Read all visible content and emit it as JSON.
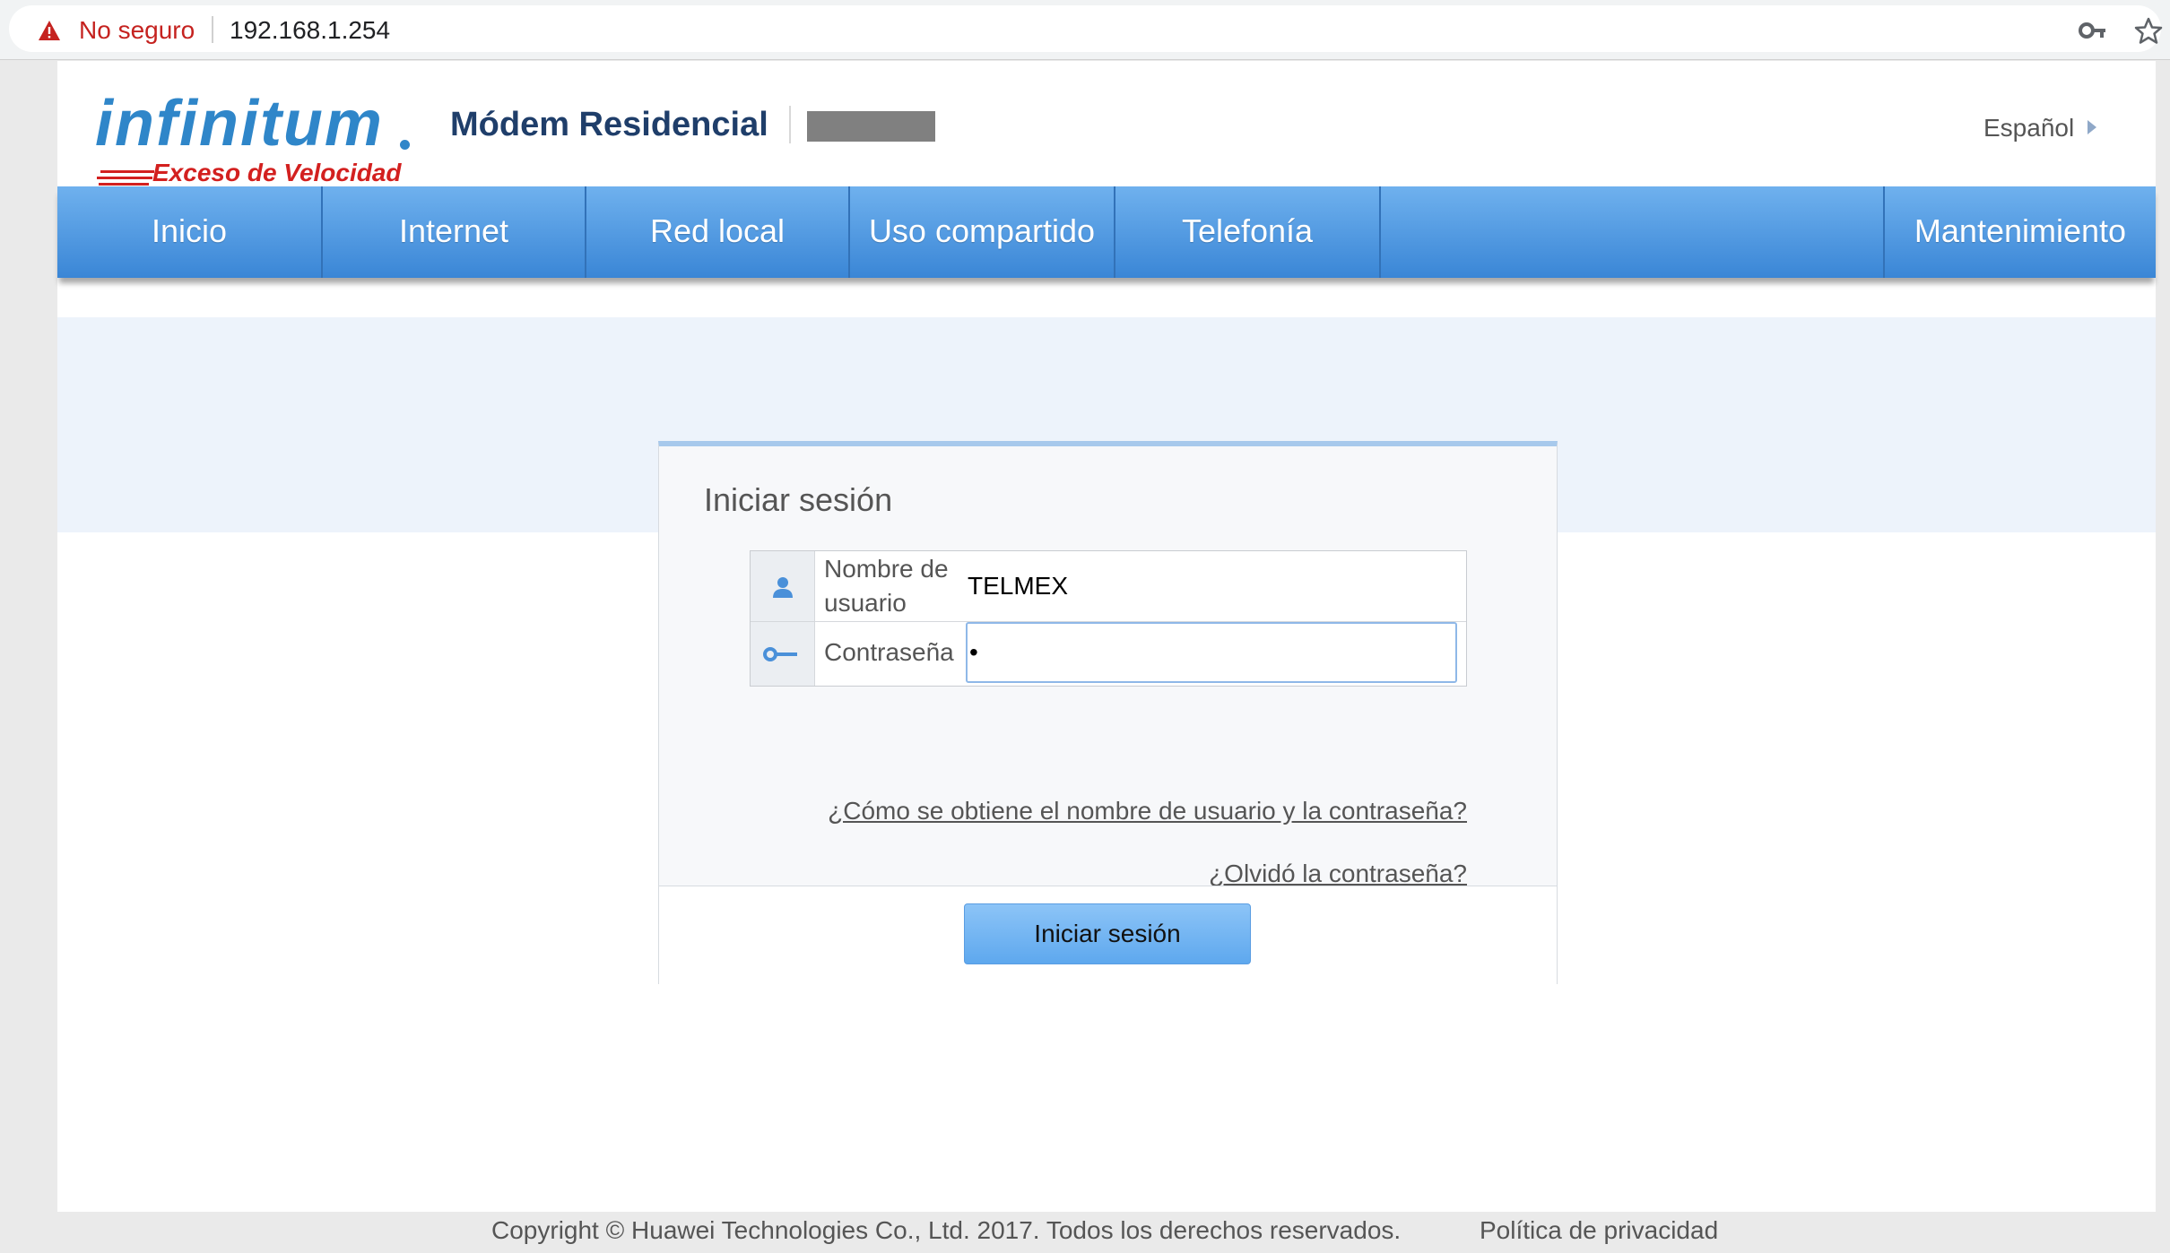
{
  "browser": {
    "security_label": "No seguro",
    "url": "192.168.1.254",
    "icons": [
      "warning-icon",
      "key-icon",
      "star-icon"
    ]
  },
  "header": {
    "logo_main": "infinitum",
    "logo_sub": "Exceso de Velocidad",
    "product_title": "Módem Residencial",
    "language": "Español"
  },
  "nav": {
    "items": [
      "Inicio",
      "Internet",
      "Red local",
      "Uso compartido",
      "Telefonía",
      "Mantenimiento"
    ]
  },
  "login": {
    "title": "Iniciar sesión",
    "username_label_line1": "Nombre de",
    "username_label_line2": "usuario",
    "username_value": "TELMEX",
    "password_label": "Contraseña",
    "password_value": "•",
    "help_link": "¿Cómo se obtiene el nombre de usuario y la contraseña?",
    "forgot_link": "¿Olvidó la contraseña?",
    "submit_label": "Iniciar sesión"
  },
  "footer": {
    "copyright": "Copyright © Huawei Technologies Co., Ltd. 2017. Todos los derechos reservados.",
    "privacy": "Política de privacidad"
  },
  "colors": {
    "nav_top": "#6fb1ee",
    "nav_bottom": "#3a86d6",
    "brand_blue": "#2f86c9",
    "brand_red": "#d3201f",
    "warning_red": "#c5221f"
  }
}
